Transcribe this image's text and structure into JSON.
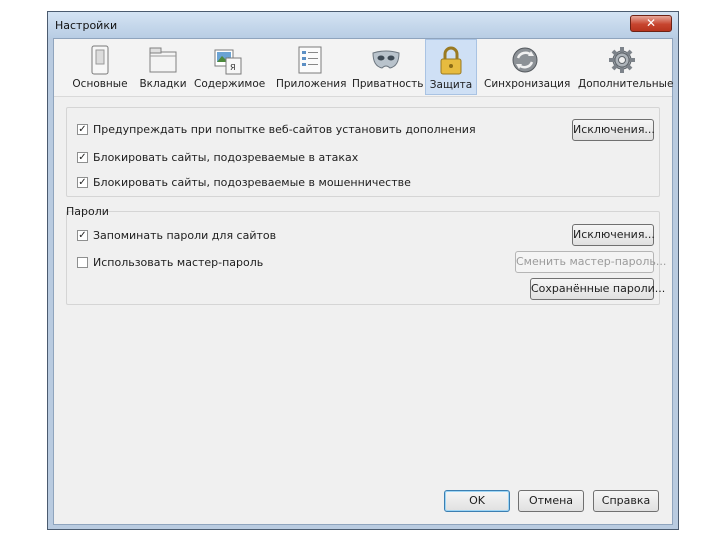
{
  "window": {
    "title": "Настройки",
    "close_glyph": "✕"
  },
  "toolbar": {
    "tabs": [
      {
        "label": "Основные",
        "icon": "switch-icon"
      },
      {
        "label": "Вкладки",
        "icon": "tabs-window-icon"
      },
      {
        "label": "Содержимое",
        "icon": "content-image-icon"
      },
      {
        "label": "Приложения",
        "icon": "applications-list-icon"
      },
      {
        "label": "Приватность",
        "icon": "mask-icon"
      },
      {
        "label": "Защита",
        "icon": "padlock-icon",
        "active": true
      },
      {
        "label": "Синхронизация",
        "icon": "sync-globe-icon"
      },
      {
        "label": "Дополнительные",
        "icon": "gear-icon"
      }
    ]
  },
  "security": {
    "warn_addons": {
      "label": "Предупреждать при попытке веб-сайтов установить дополнения",
      "checked": true
    },
    "exceptions_addons": "Исключения...",
    "block_attack": {
      "label": "Блокировать сайты, подозреваемые в атаках",
      "checked": true
    },
    "block_forgery": {
      "label": "Блокировать сайты, подозреваемые в мошенничестве",
      "checked": true
    }
  },
  "passwords": {
    "group_title": "Пароли",
    "remember": {
      "label": "Запоминать пароли для сайтов",
      "checked": true
    },
    "exceptions_passwords": "Исключения...",
    "master": {
      "label": "Использовать мастер-пароль",
      "checked": false
    },
    "change_master": "Сменить мастер-пароль...",
    "saved_passwords": "Сохранённые пароли..."
  },
  "footer": {
    "ok": "OK",
    "cancel": "Отмена",
    "help": "Справка"
  },
  "check_glyph": "✓"
}
